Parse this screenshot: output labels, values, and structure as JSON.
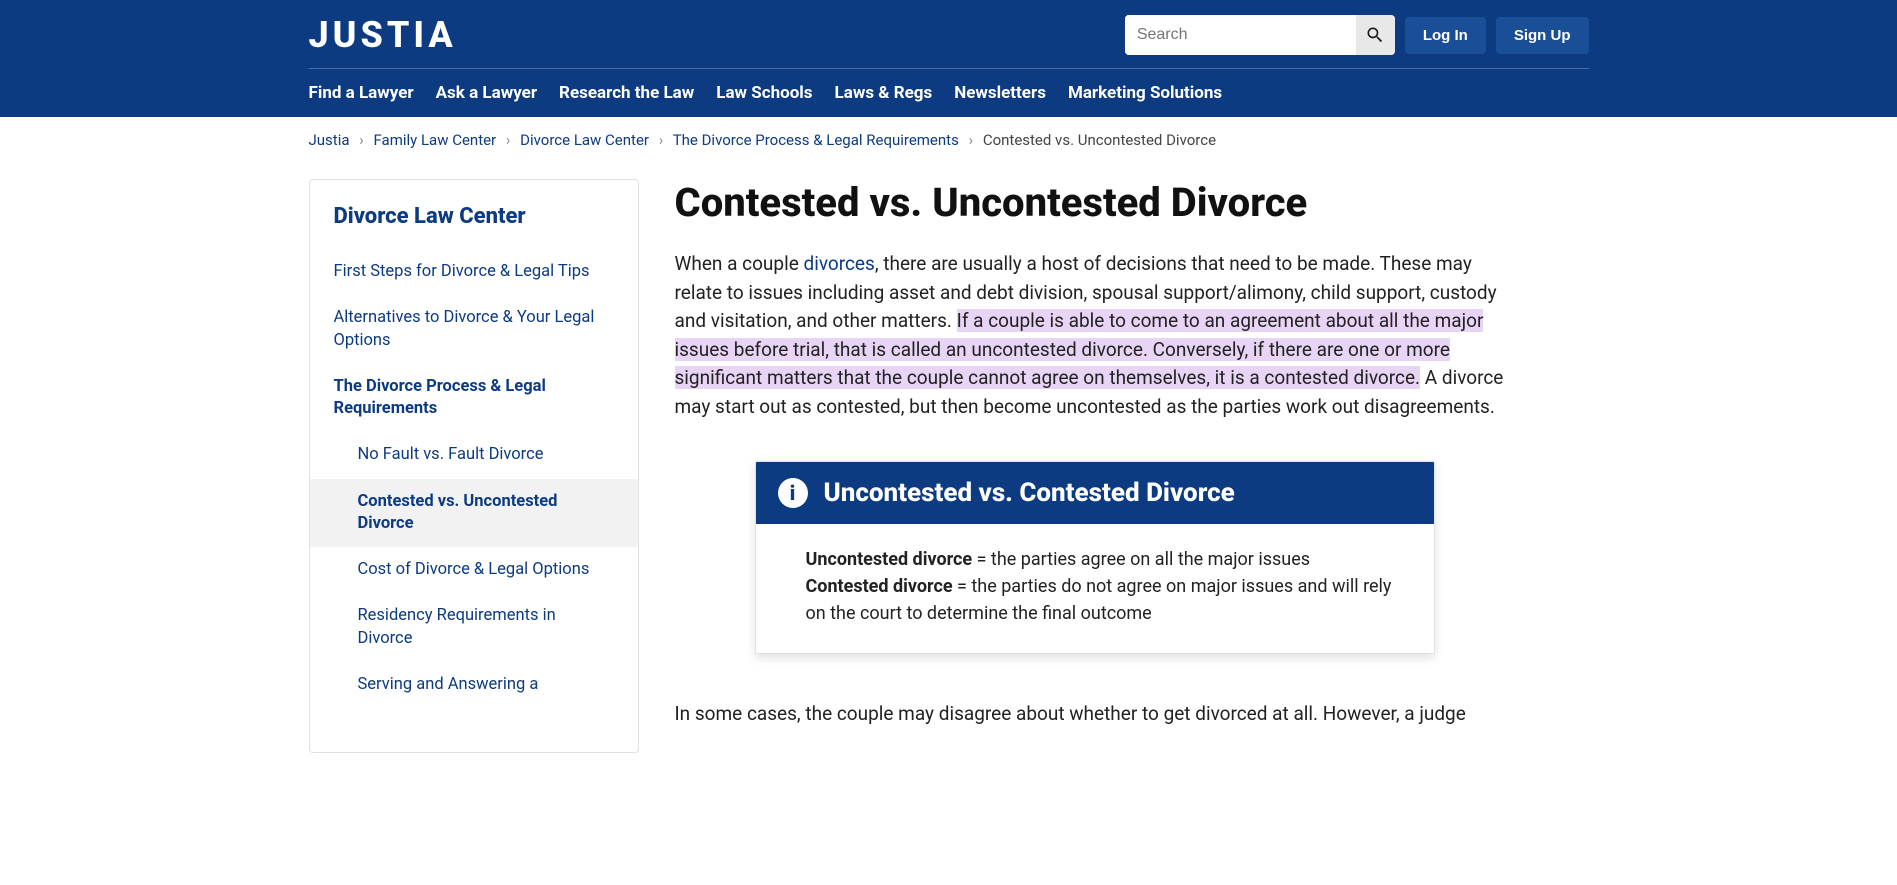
{
  "header": {
    "logo": "JUSTIA",
    "search_placeholder": "Search",
    "login": "Log In",
    "signup": "Sign Up",
    "nav": [
      "Find a Lawyer",
      "Ask a Lawyer",
      "Research the Law",
      "Law Schools",
      "Laws & Regs",
      "Newsletters",
      "Marketing Solutions"
    ]
  },
  "breadcrumb": {
    "items": [
      "Justia",
      "Family Law Center",
      "Divorce Law Center",
      "The Divorce Process & Legal Requirements"
    ],
    "current": "Contested vs. Uncontested Divorce"
  },
  "sidebar": {
    "title": "Divorce Law Center",
    "items": [
      "First Steps for Divorce & Legal Tips",
      "Alternatives to Divorce & Your Legal Options",
      "The Divorce Process & Legal Requirements",
      "No Fault vs. Fault Divorce",
      "Contested vs. Uncontested Divorce",
      "Cost of Divorce & Legal Options",
      "Residency Requirements in Divorce",
      "Serving and Answering a"
    ]
  },
  "article": {
    "title": "Contested vs. Uncontested Divorce",
    "p1_a": "When a couple ",
    "p1_link": "divorces",
    "p1_b": ", there are usually a host of decisions that need to be made. These may relate to issues including asset and debt division, spousal support/alimony, child support, custody and visitation, and other matters. ",
    "p1_hl": "If a couple is able to come to an agreement about all the major issues before trial, that is called an uncontested divorce. Conversely, if there are one or more significant matters that the couple cannot agree on themselves, it is a contested divorce.",
    "p1_c": " A divorce may start out as contested, but then become uncontested as the parties work out disagreements.",
    "callout": {
      "title": "Uncontested vs. Contested Divorce",
      "l1a": "Uncontested divorce",
      "l1b": " = the parties agree on all the major issues",
      "l2a": "Contested divorce",
      "l2b": " = the parties do not agree on major issues and will rely on the court to determine the final outcome"
    },
    "p2": "In some cases, the couple may disagree about whether to get divorced at all. However, a judge"
  }
}
